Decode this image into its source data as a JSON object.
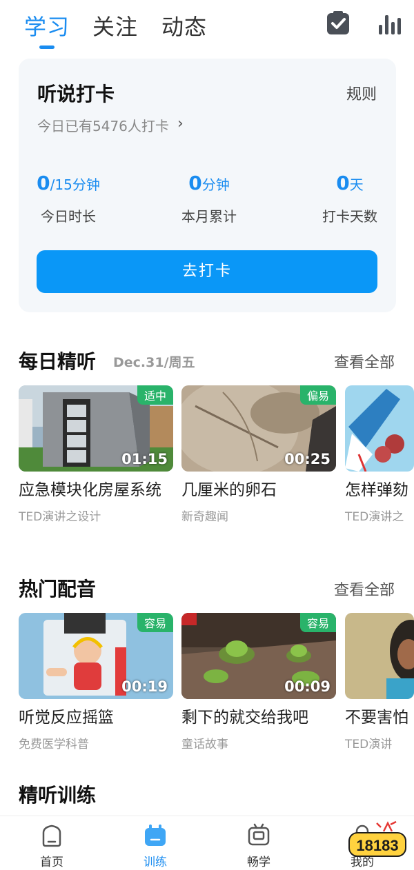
{
  "top_tabs": [
    "学习",
    "关注",
    "动态"
  ],
  "top_icons": {
    "checkin": "clipboard-check-icon",
    "stats": "bar-chart-icon"
  },
  "card": {
    "title": "听说打卡",
    "rule": "规则",
    "sub": "今日已有5476人打卡",
    "arrow": "›",
    "stats": [
      {
        "value": "0",
        "unit": "/15分钟",
        "label": "今日时长"
      },
      {
        "value": "0",
        "unit": "分钟",
        "label": "本月累计"
      },
      {
        "value": "0",
        "unit": "天",
        "label": "打卡天数"
      }
    ],
    "button": "去打卡"
  },
  "daily": {
    "title": "每日精听",
    "date": "Dec.31/周五",
    "more": "查看全部",
    "items": [
      {
        "title": "应急模块化房屋系统",
        "subtitle": "TED演讲之设计",
        "badge": "适中",
        "duration": "01:15"
      },
      {
        "title": "几厘米的卵石",
        "subtitle": "新奇趣闻",
        "badge": "偏易",
        "duration": "00:25"
      },
      {
        "title": "怎样弹劾",
        "subtitle": "TED演讲之"
      }
    ]
  },
  "dub": {
    "title": "热门配音",
    "more": "查看全部",
    "items": [
      {
        "title": "听觉反应摇篮",
        "subtitle": "免费医学科普",
        "badge": "容易",
        "duration": "00:19"
      },
      {
        "title": "剩下的就交给我吧",
        "subtitle": "童话故事",
        "badge": "容易",
        "duration": "00:09"
      },
      {
        "title": "不要害怕",
        "subtitle": "TED演讲"
      }
    ]
  },
  "training": {
    "title": "精听训练"
  },
  "bottom_nav": [
    {
      "label": "首页",
      "icon": "home-icon"
    },
    {
      "label": "训练",
      "icon": "training-icon"
    },
    {
      "label": "畅学",
      "icon": "tv-icon"
    },
    {
      "label": "我的",
      "icon": "profile-icon"
    }
  ],
  "watermark": "18183",
  "colors": {
    "accent": "#1a8cf0",
    "button": "#0a97f7",
    "badge": "#29b36a"
  }
}
